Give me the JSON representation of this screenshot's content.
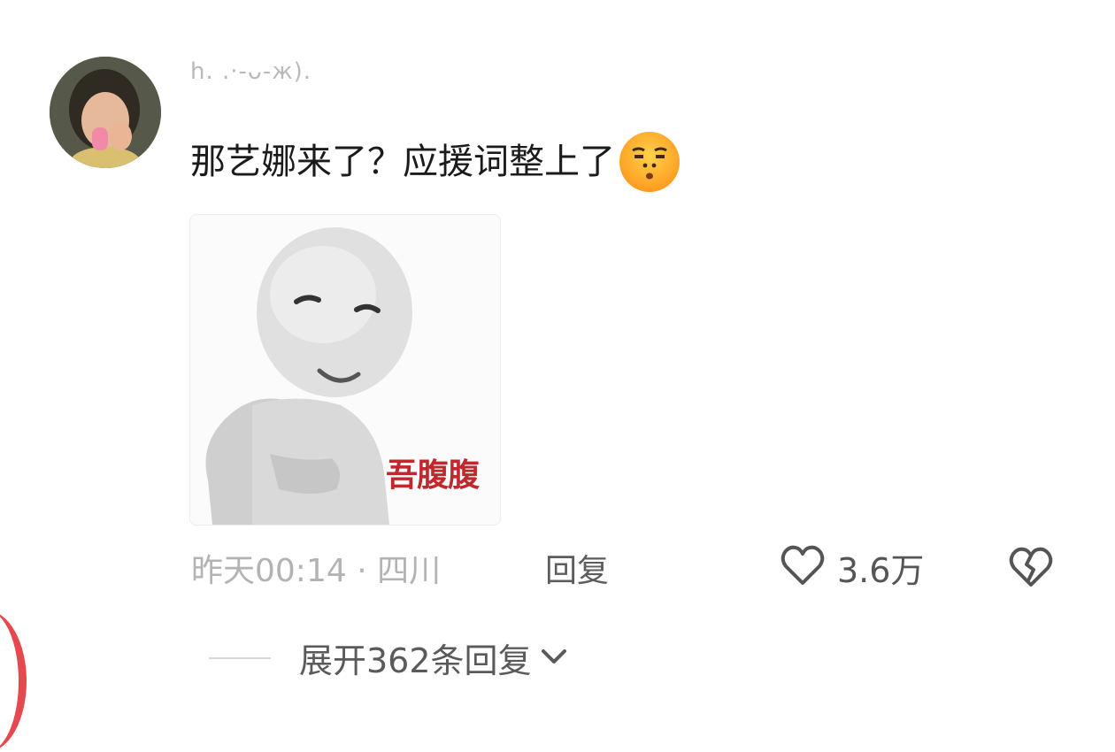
{
  "comment": {
    "username": "h.       .·-ᴗ-ж).",
    "text": "那艺娜来了？应援词整上了",
    "emoji_icon": "smug-face-emoji",
    "sticker": {
      "icon": "white-figure-meme-sticker",
      "caption": "吾腹腹",
      "caption_color": "#c0282d"
    },
    "time_location": "昨天00:14 · 四川",
    "reply_label": "回复",
    "like_icon": "heart-outline-icon",
    "like_count": "3.6万",
    "dislike_icon": "broken-heart-icon",
    "expand_replies_label": "展开362条回复",
    "expand_icon": "chevron-down-icon"
  },
  "colors": {
    "accent_red": "#e5484d",
    "secondary_text": "#b3b3b3"
  }
}
